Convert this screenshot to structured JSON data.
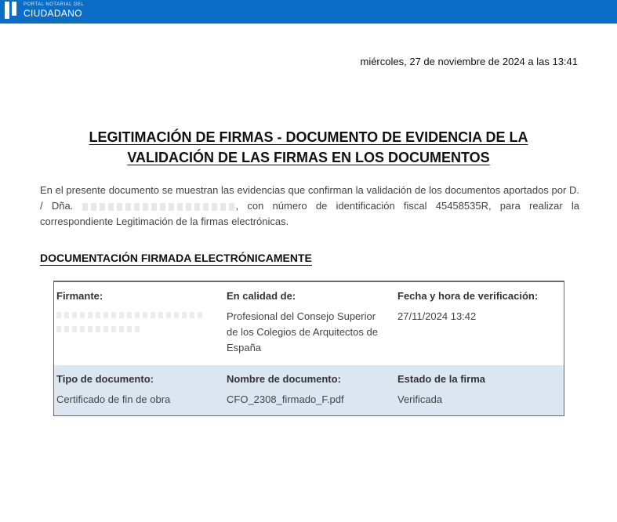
{
  "header": {
    "logo_small": "PORTAL NOTARIAL DEL",
    "logo_big": "CIUDADANO",
    "bar_color": "#0a6ec7"
  },
  "date_line": "miércoles, 27 de noviembre de 2024 a las 13:41",
  "title": {
    "line1": "LEGITIMACIÓN DE FIRMAS - DOCUMENTO DE EVIDENCIA DE LA",
    "line2": "VALIDACIÓN DE LAS FIRMAS EN LOS DOCUMENTOS"
  },
  "intro": {
    "before": "En el presente documento se muestran las evidencias que confirman la validación de los documentos aportados por D. / Dña.",
    "after": ", con número de identificación fiscal 45458535R, para realizar la correspondiente Legitimación de la firmas electrónicas."
  },
  "section_title": "DOCUMENTACIÓN FIRMADA ELECTRÓNICAMENTE",
  "table": {
    "row1": {
      "firmante_label": "Firmante:",
      "calidad_label": "En calidad de:",
      "calidad_value": "Profesional del Consejo Superior de los Colegios de Arquitectos de España",
      "fecha_label": "Fecha y hora de verificación:",
      "fecha_value": "27/11/2024 13:42"
    },
    "row2": {
      "tipo_label": "Tipo de documento:",
      "tipo_value": "Certificado de fin de obra",
      "nombre_label": "Nombre de documento:",
      "nombre_value": "CFO_2308_firmado_F.pdf",
      "estado_label": "Estado de la firma",
      "estado_value": "Verificada"
    },
    "row2_bg": "#dce6f1"
  }
}
